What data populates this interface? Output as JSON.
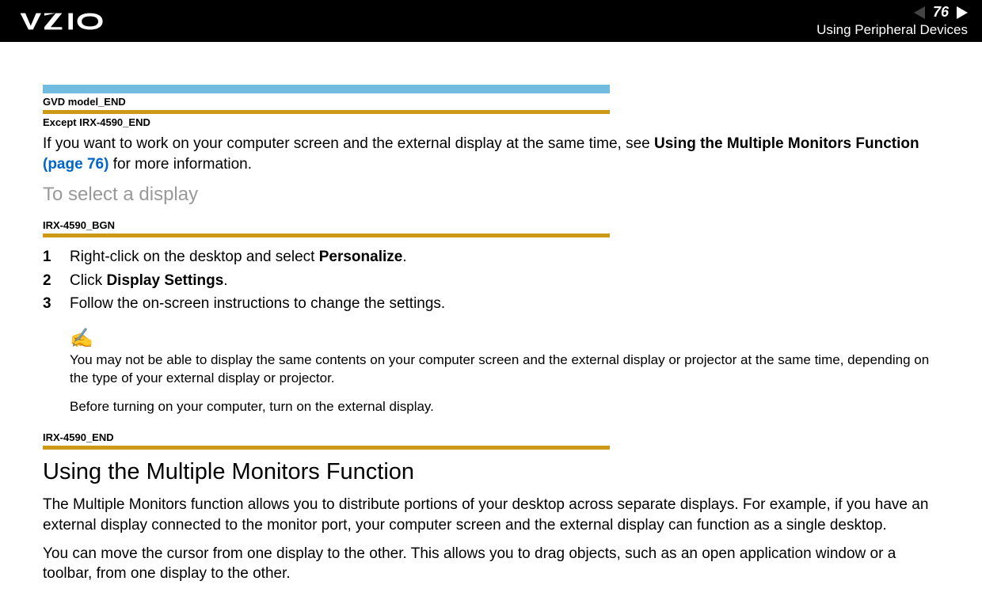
{
  "header": {
    "page_number": "76",
    "breadcrumb": "Using Peripheral Devices"
  },
  "tags": {
    "gvd_model": "GVD model_END",
    "except_irx": "Except IRX-4590_END",
    "irx_bgn": "IRX-4590_BGN",
    "irx_end": "IRX-4590_END"
  },
  "intro": {
    "prefix": "If you want to work on your computer screen and the external display at the same time, see ",
    "bold_text": "Using the Multiple Monitors Function ",
    "link_text": "(page 76)",
    "suffix": " for more information."
  },
  "subheading": "To select a display",
  "steps": [
    {
      "num": "1",
      "prefix": "Right-click on the desktop and select ",
      "bold": "Personalize",
      "suffix": "."
    },
    {
      "num": "2",
      "prefix": "Click ",
      "bold": "Display Settings",
      "suffix": "."
    },
    {
      "num": "3",
      "prefix": "Follow the on-screen instructions to change the settings.",
      "bold": "",
      "suffix": ""
    }
  ],
  "note": {
    "text1": "You may not be able to display the same contents on your computer screen and the external display or projector at the same time, depending on the type of your external display or projector.",
    "text2": "Before turning on your computer, turn on the external display."
  },
  "section": {
    "heading": "Using the Multiple Monitors Function",
    "para1": "The Multiple Monitors function allows you to distribute portions of your desktop across separate displays. For example, if you have an external display connected to the monitor port, your computer screen and the external display can function as a single desktop.",
    "para2": "You can move the cursor from one display to the other. This allows you to drag objects, such as an open application window or a toolbar, from one display to the other."
  }
}
